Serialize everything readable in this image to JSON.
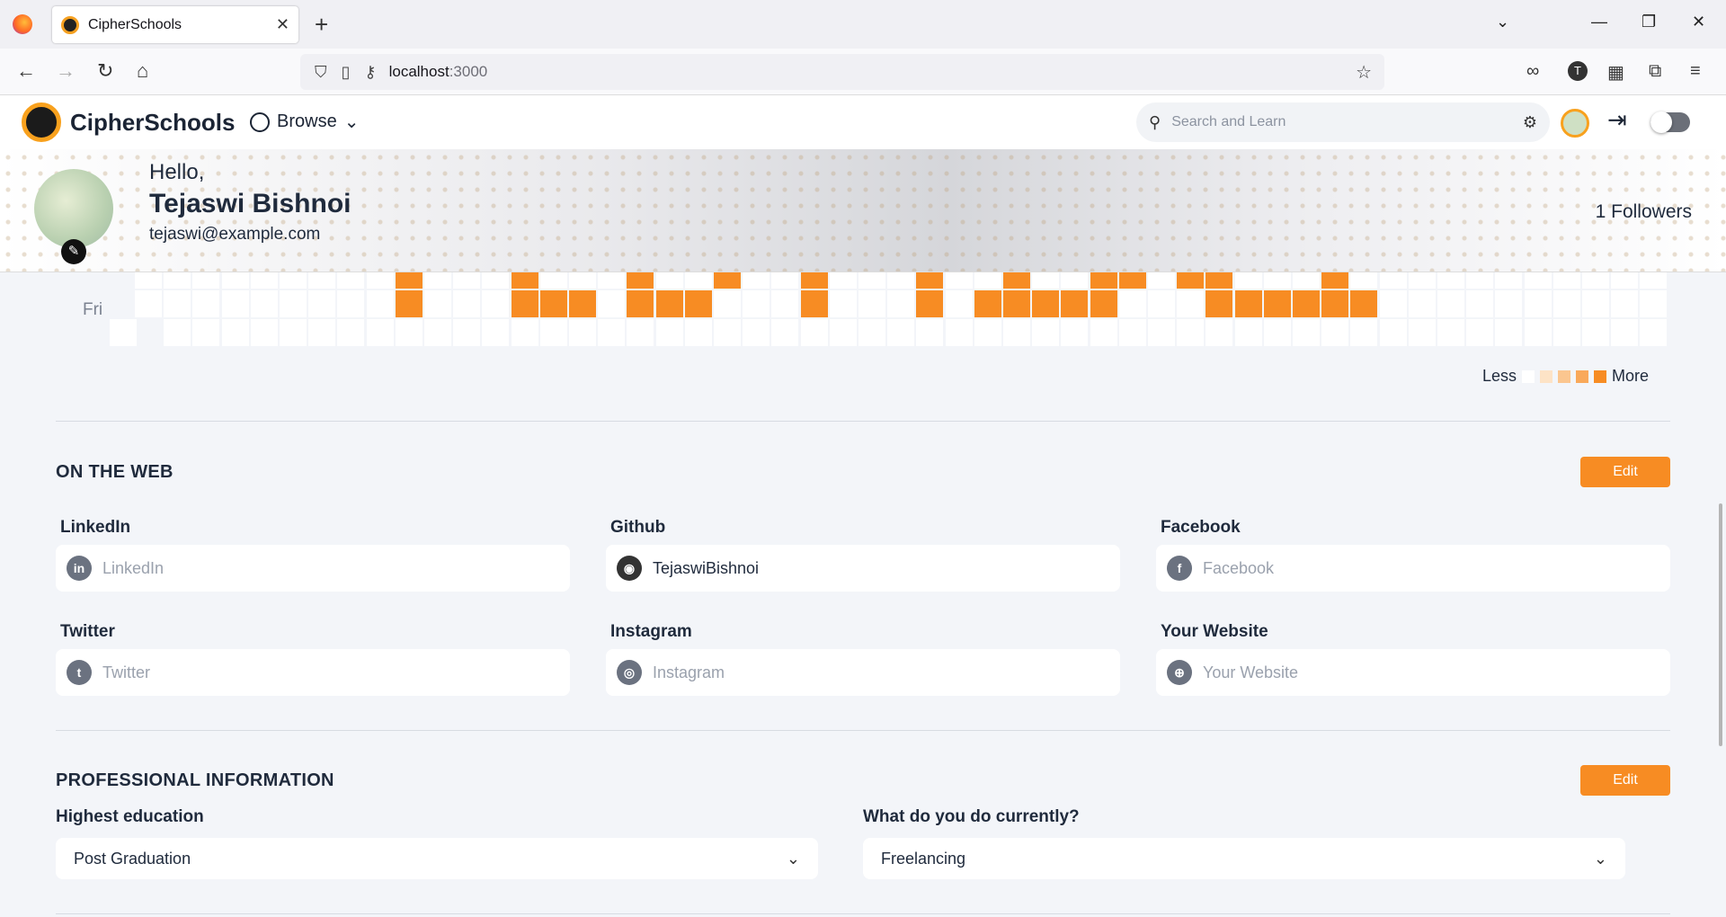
{
  "browser": {
    "tab_title": "CipherSchools",
    "url_host": "localhost",
    "url_port": ":3000"
  },
  "header": {
    "brand": "CipherSchools",
    "browse": "Browse",
    "search_placeholder": "Search and Learn"
  },
  "profile": {
    "greeting": "Hello,",
    "name": "Tejaswi Bishnoi",
    "email": "tejaswi@example.com",
    "followers": "1 Followers"
  },
  "heatmap": {
    "day_label": "Fri",
    "legend_less": "Less",
    "legend_more": "More",
    "legend_colors": [
      "#ffffff",
      "#fde3c6",
      "#fbc68f",
      "#f9a95a",
      "#f78c23"
    ]
  },
  "on_the_web": {
    "title": "ON THE WEB",
    "edit": "Edit",
    "fields": [
      {
        "label": "LinkedIn",
        "value": "",
        "placeholder": "LinkedIn",
        "icon": "linkedin-icon"
      },
      {
        "label": "Github",
        "value": "TejaswiBishnoi",
        "placeholder": "",
        "icon": "github-icon"
      },
      {
        "label": "Facebook",
        "value": "",
        "placeholder": "Facebook",
        "icon": "facebook-icon"
      },
      {
        "label": "Twitter",
        "value": "",
        "placeholder": "Twitter",
        "icon": "twitter-icon"
      },
      {
        "label": "Instagram",
        "value": "",
        "placeholder": "Instagram",
        "icon": "instagram-icon"
      },
      {
        "label": "Your Website",
        "value": "",
        "placeholder": "Your Website",
        "icon": "globe-icon"
      }
    ]
  },
  "professional": {
    "title": "PROFESSIONAL INFORMATION",
    "edit": "Edit",
    "education_label": "Highest education",
    "education_value": "Post Graduation",
    "current_label": "What do you do currently?",
    "current_value": "Freelancing"
  },
  "colors": {
    "accent": "#f78c23",
    "text": "#1f2a3c",
    "background": "#f3f5f9"
  }
}
